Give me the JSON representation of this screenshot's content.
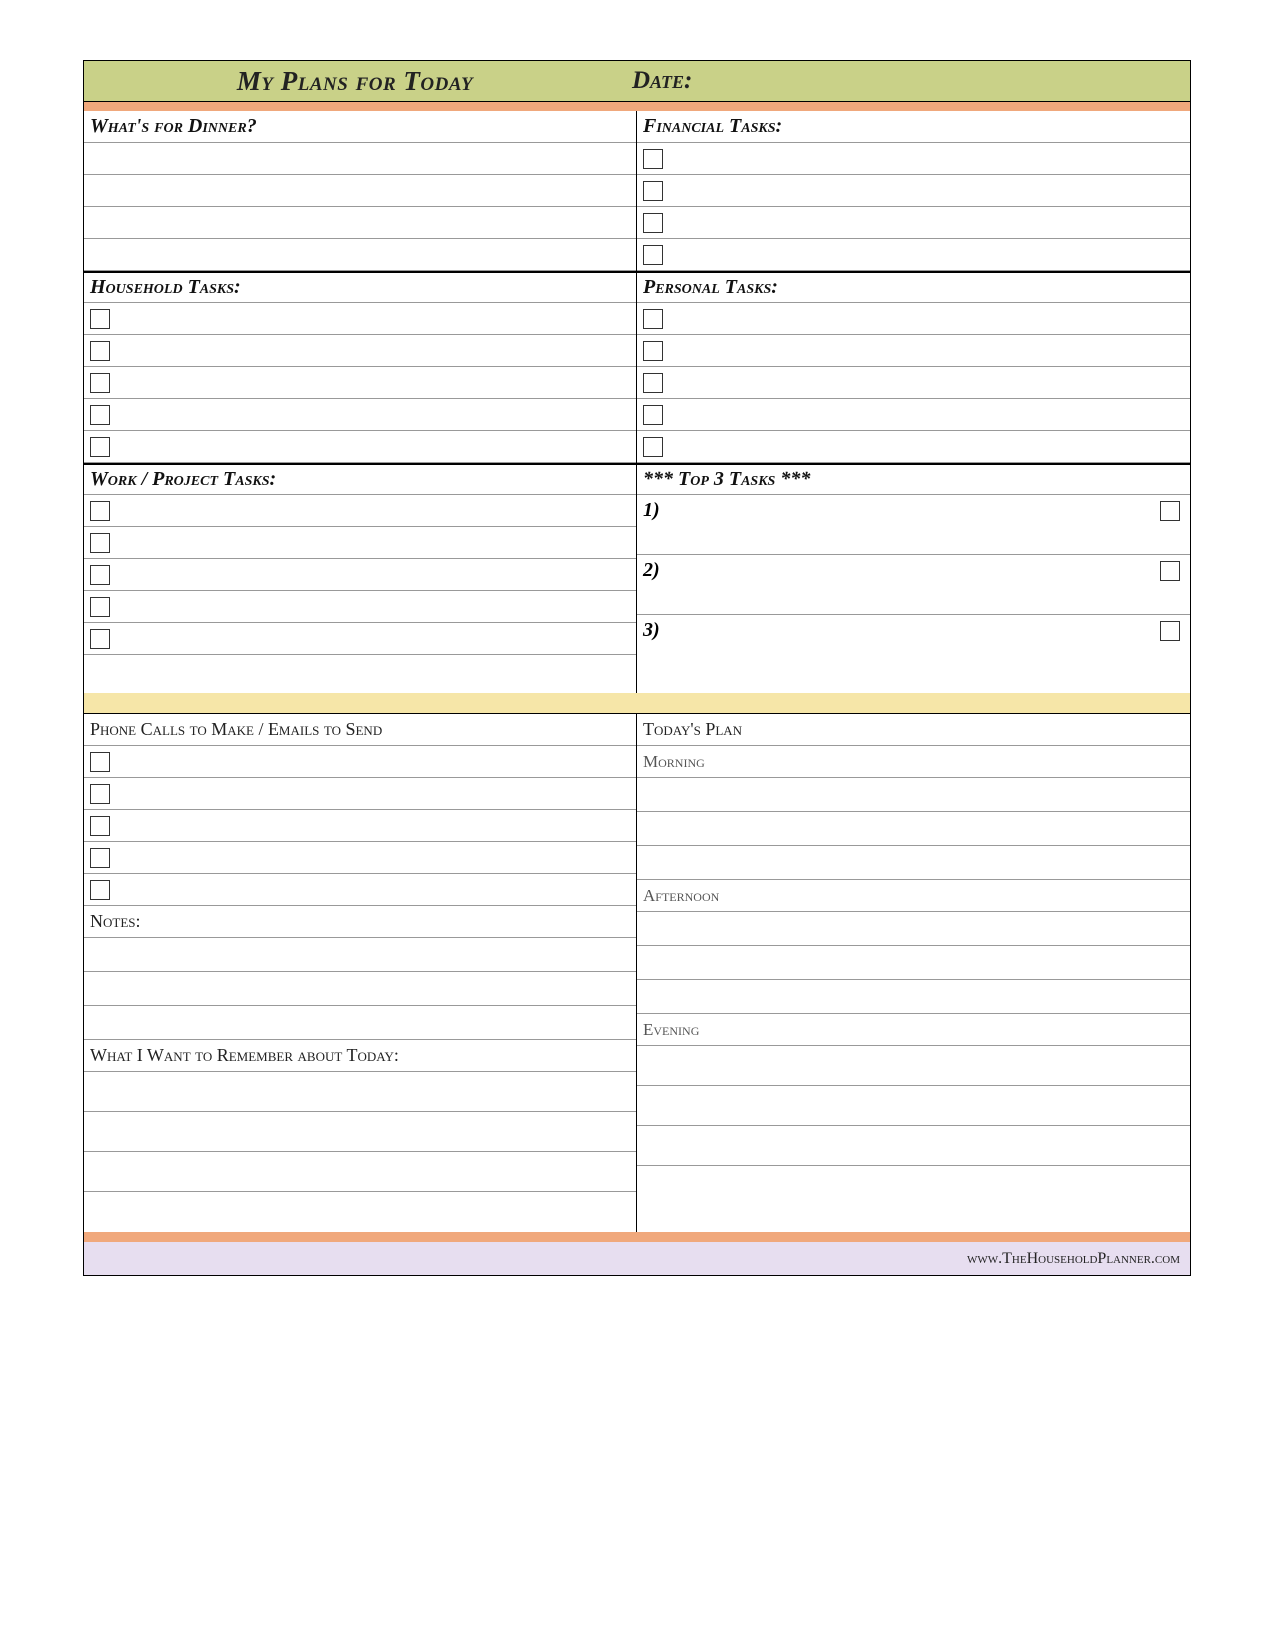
{
  "header": {
    "title": "My Plans for Today",
    "date_label": "Date:"
  },
  "sections": {
    "dinner": "What's for Dinner?",
    "financial": "Financial Tasks:",
    "household": "Household Tasks:",
    "personal": "Personal Tasks:",
    "work": "Work / Project Tasks:",
    "top3": "*** Top 3 Tasks ***",
    "top3_items": [
      "1)",
      "2)",
      "3)"
    ],
    "phone": "Phone Calls to Make / Emails to Send",
    "todays_plan": "Today's Plan",
    "morning": "Morning",
    "afternoon": "Afternoon",
    "evening": "Evening",
    "notes": "Notes:",
    "remember": "What I Want to Remember about Today:"
  },
  "footer": {
    "url": "www.TheHouseholdPlanner.com"
  }
}
